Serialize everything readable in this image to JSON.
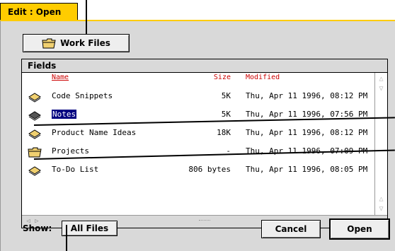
{
  "tab": {
    "title": "Edit : Open"
  },
  "folder_button": {
    "label": "Work Files",
    "icon": "folder-icon"
  },
  "panel": {
    "title": "Fields",
    "columns": {
      "name": "Name",
      "size": "Size",
      "modified": "Modified"
    },
    "rows": [
      {
        "name": "Code Snippets",
        "size": "5K",
        "modified": "Thu, Apr 11 1996, 08:12 PM",
        "icon": "document-icon"
      },
      {
        "name": "Notes",
        "size": "5K",
        "modified": "Thu, Apr 11 1996, 07:56 PM",
        "icon": "document-icon",
        "selected": true
      },
      {
        "name": "Product Name Ideas",
        "size": "18K",
        "modified": "Thu, Apr 11 1996, 08:12 PM",
        "icon": "document-icon"
      },
      {
        "name": "Projects",
        "size": "-",
        "modified": "Thu, Apr 11 1996, 07:09 PM",
        "icon": "folder-icon"
      },
      {
        "name": "To-Do List",
        "size": "806 bytes",
        "modified": "Thu, Apr 11 1996, 08:05 PM",
        "icon": "document-icon"
      }
    ]
  },
  "footer": {
    "show_label": "Show:",
    "show_value": "All Files",
    "cancel": "Cancel",
    "open": "Open"
  },
  "colors": {
    "accent": "#ffcc00",
    "header_text": "#cc0000",
    "selection": "#000080"
  }
}
